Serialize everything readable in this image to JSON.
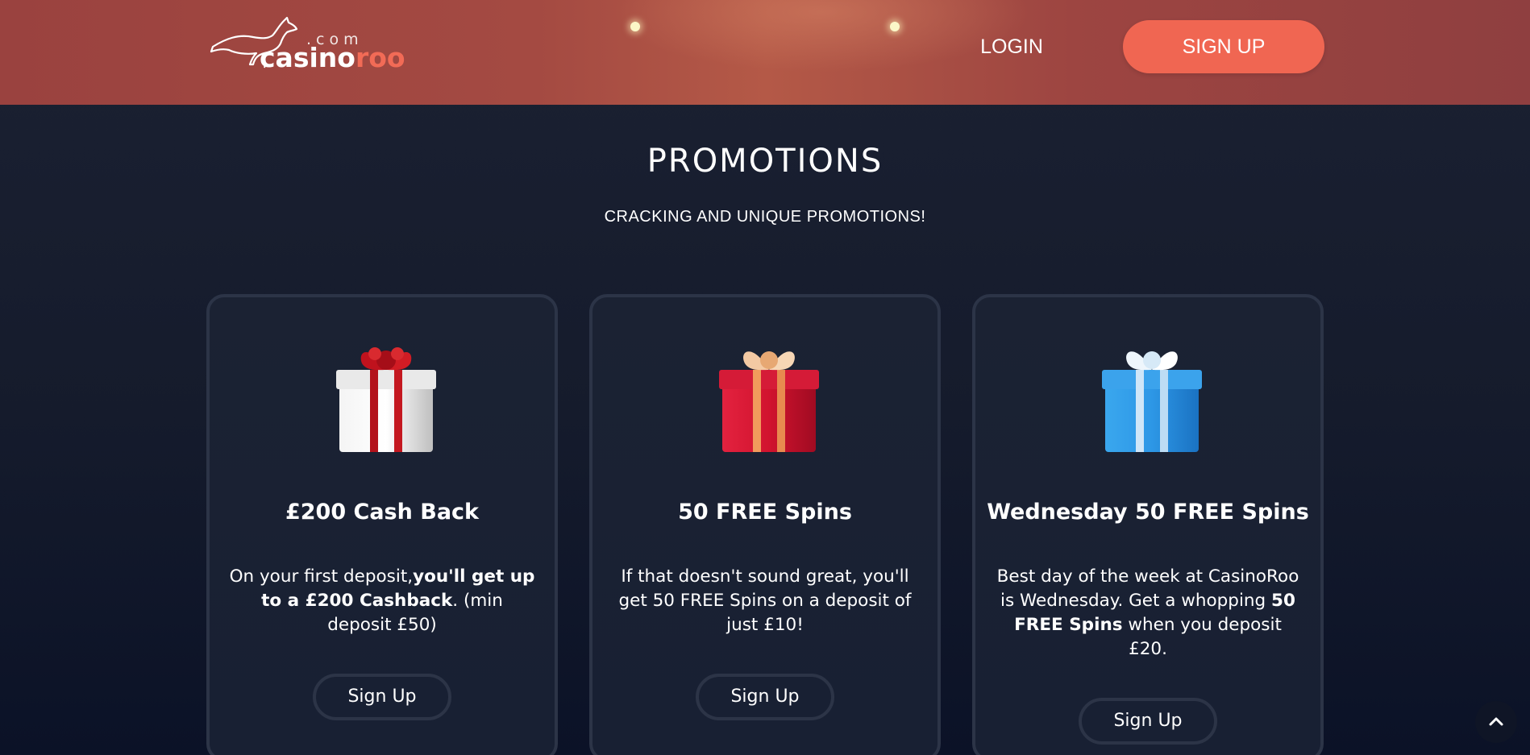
{
  "header": {
    "logo": {
      "dotcom": ".com",
      "brand_part1": "casino",
      "brand_part2": "roo"
    },
    "login_label": "LOGIN",
    "signup_label": "SIGN UP"
  },
  "section": {
    "title": "PROMOTIONS",
    "subtitle": "CRACKING AND UNIQUE PROMOTIONS!"
  },
  "cards": [
    {
      "title": "£200 Cash Back",
      "desc_plain_1": "On your first deposit,",
      "desc_bold": "you'll get up to a £200 Cashback",
      "desc_plain_2": ". (min deposit £50)",
      "button": "Sign Up",
      "gift_icon": "white-gift-box-red-ribbon"
    },
    {
      "title": "50 FREE Spins",
      "desc_plain_1": "If that doesn't sound great, you'll get 50 FREE Spins on a deposit of just £10!",
      "button": "Sign Up",
      "gift_icon": "red-gift-box-gold-ribbon"
    },
    {
      "title": "Wednesday 50 FREE Spins",
      "desc_plain_1": "Best day of the week at CasinoRoo is Wednesday. Get a whopping ",
      "desc_bold": "50 FREE Spins",
      "desc_plain_2": " when you deposit £20.",
      "button": "Sign Up",
      "gift_icon": "blue-gift-box-white-ribbon"
    }
  ],
  "colors": {
    "accent": "#f06652",
    "header_bg": "#a44a42",
    "page_bg": "#151b2c",
    "card_border": "#2c3447"
  },
  "icons": {
    "back_to_top": "chevron-up-icon",
    "logo": "kangaroo-logo-icon"
  }
}
